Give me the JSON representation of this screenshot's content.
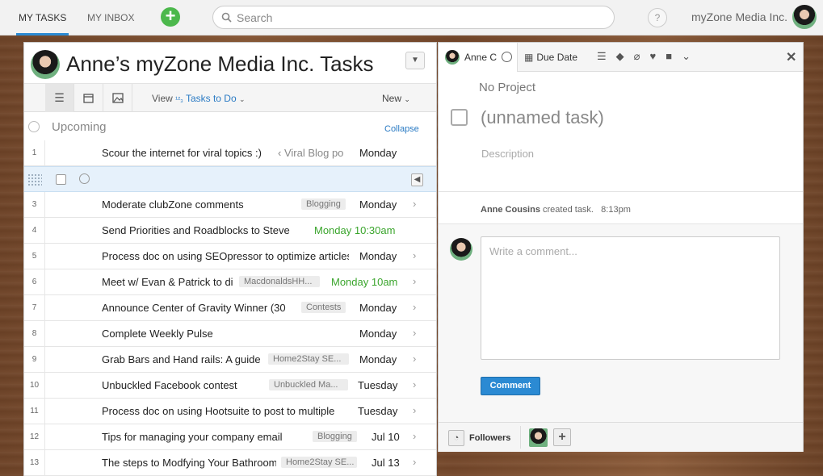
{
  "topbar": {
    "my_tasks": "MY TASKS",
    "my_inbox": "MY INBOX",
    "add_icon": "plus-icon",
    "search_placeholder": "Search",
    "help": "?",
    "org_name": "myZone Media Inc."
  },
  "left": {
    "title": "Anne’s myZone Media Inc. Tasks",
    "toolbar": {
      "view_label": "View",
      "view_value": "Tasks to Do",
      "new_label": "New"
    },
    "section": {
      "label": "Upcoming",
      "collapse": "Collapse"
    },
    "rows": [
      {
        "num": "1",
        "name": "Scour the internet for viral topics :)",
        "plink": "‹ Viral Blog po",
        "due": "Monday",
        "due_green": false
      },
      {
        "num": "3",
        "name": "Moderate clubZone comments",
        "proj": "Blogging",
        "due": "Monday",
        "due_green": false
      },
      {
        "num": "4",
        "name": "Send Priorities and Roadblocks to Steve",
        "due": "Monday 10:30am",
        "due_green": true
      },
      {
        "num": "5",
        "name": "Process doc on using SEOpressor to optimize articles",
        "due": "Monday",
        "due_green": false
      },
      {
        "num": "6",
        "name": "Meet w/ Evan & Patrick to discuss",
        "proj": "MacdonaldsHH...",
        "due": "Monday 10am",
        "due_green": true
      },
      {
        "num": "7",
        "name": "Announce Center of Gravity Winner (30",
        "proj": "Contests",
        "due": "Monday",
        "due_green": false
      },
      {
        "num": "8",
        "name": "Complete Weekly Pulse",
        "due": "Monday",
        "due_green": false
      },
      {
        "num": "9",
        "name": "Grab Bars and Hand rails: A guide",
        "proj": "Home2Stay SE...",
        "due": "Monday",
        "due_green": false
      },
      {
        "num": "10",
        "name": "Unbuckled Facebook contest",
        "proj": "Unbuckled Ma...",
        "due": "Tuesday",
        "due_green": false
      },
      {
        "num": "11",
        "name": "Process doc on using Hootsuite to post to multiple",
        "due": "Tuesday",
        "due_green": false
      },
      {
        "num": "12",
        "name": "Tips for managing your company email",
        "proj": "Blogging",
        "due": "Jul 10",
        "due_green": false
      },
      {
        "num": "13",
        "name": "The steps to Modfying Your Bathroom",
        "proj": "Home2Stay SE...",
        "due": "Jul 13",
        "due_green": false
      }
    ]
  },
  "right": {
    "assignee": "Anne C",
    "due_date": "Due Date",
    "project": "No Project",
    "task_name": "(unnamed task)",
    "description_placeholder": "Description",
    "activity_user": "Anne Cousins",
    "activity_text": "created task.",
    "activity_time": "8:13pm",
    "comment_placeholder": "Write a comment...",
    "comment_button": "Comment",
    "followers": "Followers"
  }
}
